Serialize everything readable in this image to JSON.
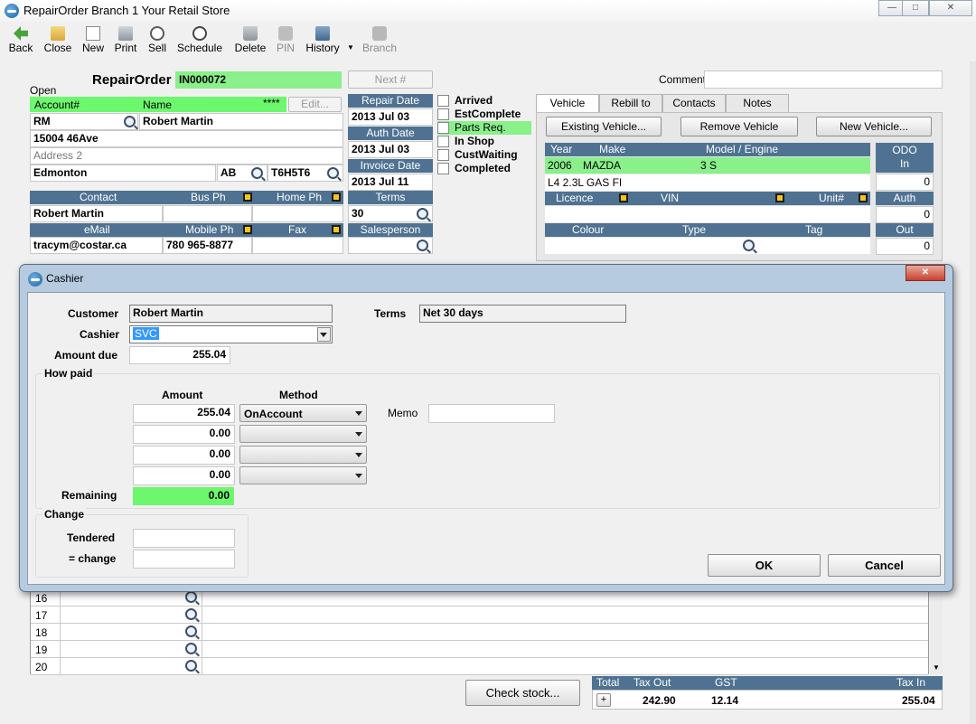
{
  "window": {
    "title": "RepairOrder  Branch 1  Your Retail Store"
  },
  "toolbar": {
    "back": "Back",
    "close": "Close",
    "new": "New",
    "print": "Print",
    "sell": "Sell",
    "schedule": "Schedule",
    "delete": "Delete",
    "pin": "PIN",
    "history": "History",
    "branch": "Branch"
  },
  "order": {
    "title": "RepairOrder",
    "number": "IN000072",
    "next_button": "Next #",
    "status": "Open",
    "comment_label": "Comment",
    "comment_value": ""
  },
  "customer": {
    "account_header": "Account#",
    "name_header": "Name",
    "masked": "****",
    "edit_button": "Edit...",
    "account": "RM",
    "name": "Robert Martin",
    "address1": "15004 46Ave",
    "address2_placeholder": "Address 2",
    "city": "Edmonton",
    "province": "AB",
    "postal": "T6H5T6",
    "contact_header": "Contact",
    "bus_ph_header": "Bus Ph",
    "home_ph_header": "Home Ph",
    "contact": "Robert Martin",
    "bus_ph": "",
    "home_ph": "",
    "email_header": "eMail",
    "mobile_header": "Mobile Ph",
    "fax_header": "Fax",
    "email": "tracym@costar.ca",
    "mobile": "780 965-8877",
    "fax": ""
  },
  "dates": {
    "repair_label": "Repair Date",
    "repair": "2013 Jul 03",
    "auth_label": "Auth Date",
    "auth": "2013 Jul 03",
    "invoice_label": "Invoice Date",
    "invoice": "2013 Jul 11",
    "terms_label": "Terms",
    "terms": "30",
    "salesperson_label": "Salesperson",
    "salesperson": ""
  },
  "status_flags": [
    {
      "label": "Arrived",
      "checked": false
    },
    {
      "label": "EstComplete",
      "checked": false
    },
    {
      "label": "Parts Req.",
      "checked": false
    },
    {
      "label": "In Shop",
      "checked": false
    },
    {
      "label": "CustWaiting",
      "checked": false
    },
    {
      "label": "Completed",
      "checked": false
    }
  ],
  "vehicle_tabs": [
    "Vehicle",
    "Rebill to",
    "Contacts",
    "Notes"
  ],
  "vehicle": {
    "existing_button": "Existing Vehicle...",
    "remove_button": "Remove Vehicle",
    "new_button": "New Vehicle...",
    "year_header": "Year",
    "make_header": "Make",
    "model_header": "Model / Engine",
    "year": "2006",
    "make": "MAZDA",
    "model": "3 S",
    "engine": "L4 2.3L  GAS FI",
    "odo_header": "ODO",
    "odo_in_header": "In",
    "odo_in": "0",
    "auth_header": "Auth",
    "auth": "0",
    "out_header": "Out",
    "out": "0",
    "licence_header": "Licence",
    "vin_header": "VIN",
    "unit_header": "Unit#",
    "colour_header": "Colour",
    "type_header": "Type",
    "tag_header": "Tag"
  },
  "cashier_dialog": {
    "title": "Cashier",
    "customer_label": "Customer",
    "customer": "Robert Martin",
    "terms_label": "Terms",
    "terms": "Net 30 days",
    "cashier_label": "Cashier",
    "cashier": "SVC",
    "amount_due_label": "Amount due",
    "amount_due": "255.04",
    "how_paid_label": "How paid",
    "amount_header": "Amount",
    "method_header": "Method",
    "payments": [
      {
        "amount": "255.04",
        "method": "OnAccount"
      },
      {
        "amount": "0.00",
        "method": ""
      },
      {
        "amount": "0.00",
        "method": ""
      },
      {
        "amount": "0.00",
        "method": ""
      }
    ],
    "memo_label": "Memo",
    "memo": "",
    "remaining_label": "Remaining",
    "remaining": "0.00",
    "change_label": "Change",
    "tendered_label": "Tendered",
    "tendered": "",
    "change_eq_label": "= change",
    "change_value": "",
    "ok_button": "OK",
    "cancel_button": "Cancel"
  },
  "lines": {
    "rows": [
      "16",
      "17",
      "18",
      "19",
      "20"
    ]
  },
  "footer": {
    "check_stock_button": "Check stock...",
    "total_label": "Total",
    "tax_out_label": "Tax Out",
    "gst_label": "GST",
    "tax_in_label": "Tax In",
    "expand": "+",
    "tax_out": "242.90",
    "gst": "12.14",
    "tax_in": "255.04"
  },
  "colors": {
    "header_blue": "#4f7292",
    "highlight_green": "#6df76d"
  }
}
